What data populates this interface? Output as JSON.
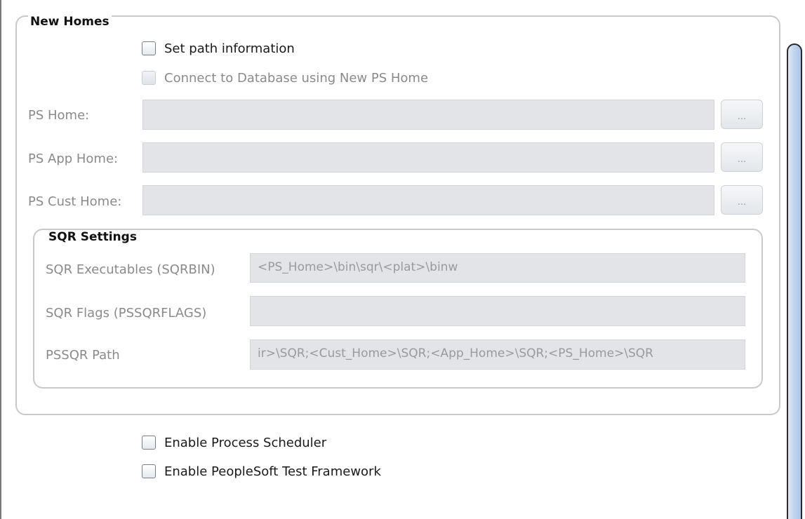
{
  "new_homes": {
    "title": "New Homes",
    "set_path_label": "Set path information",
    "connect_db_label": "Connect to Database using New PS Home",
    "fields": [
      {
        "label": "PS Home:",
        "value": "",
        "button": "..."
      },
      {
        "label": "PS App Home:",
        "value": "",
        "button": "..."
      },
      {
        "label": "PS Cust Home:",
        "value": "",
        "button": "..."
      }
    ]
  },
  "sqr_settings": {
    "title": "SQR Settings",
    "fields": [
      {
        "label": "SQR Executables (SQRBIN)",
        "value": "<PS_Home>\\bin\\sqr\\<plat>\\binw"
      },
      {
        "label": "SQR Flags (PSSQRFLAGS)",
        "value": ""
      },
      {
        "label": "PSSQR Path",
        "value": "ir>\\SQR;<Cust_Home>\\SQR;<App_Home>\\SQR;<PS_Home>\\SQR"
      }
    ]
  },
  "options": {
    "enable_process_scheduler_label": "Enable Process Scheduler",
    "enable_test_framework_label": "Enable PeopleSoft Test Framework"
  }
}
